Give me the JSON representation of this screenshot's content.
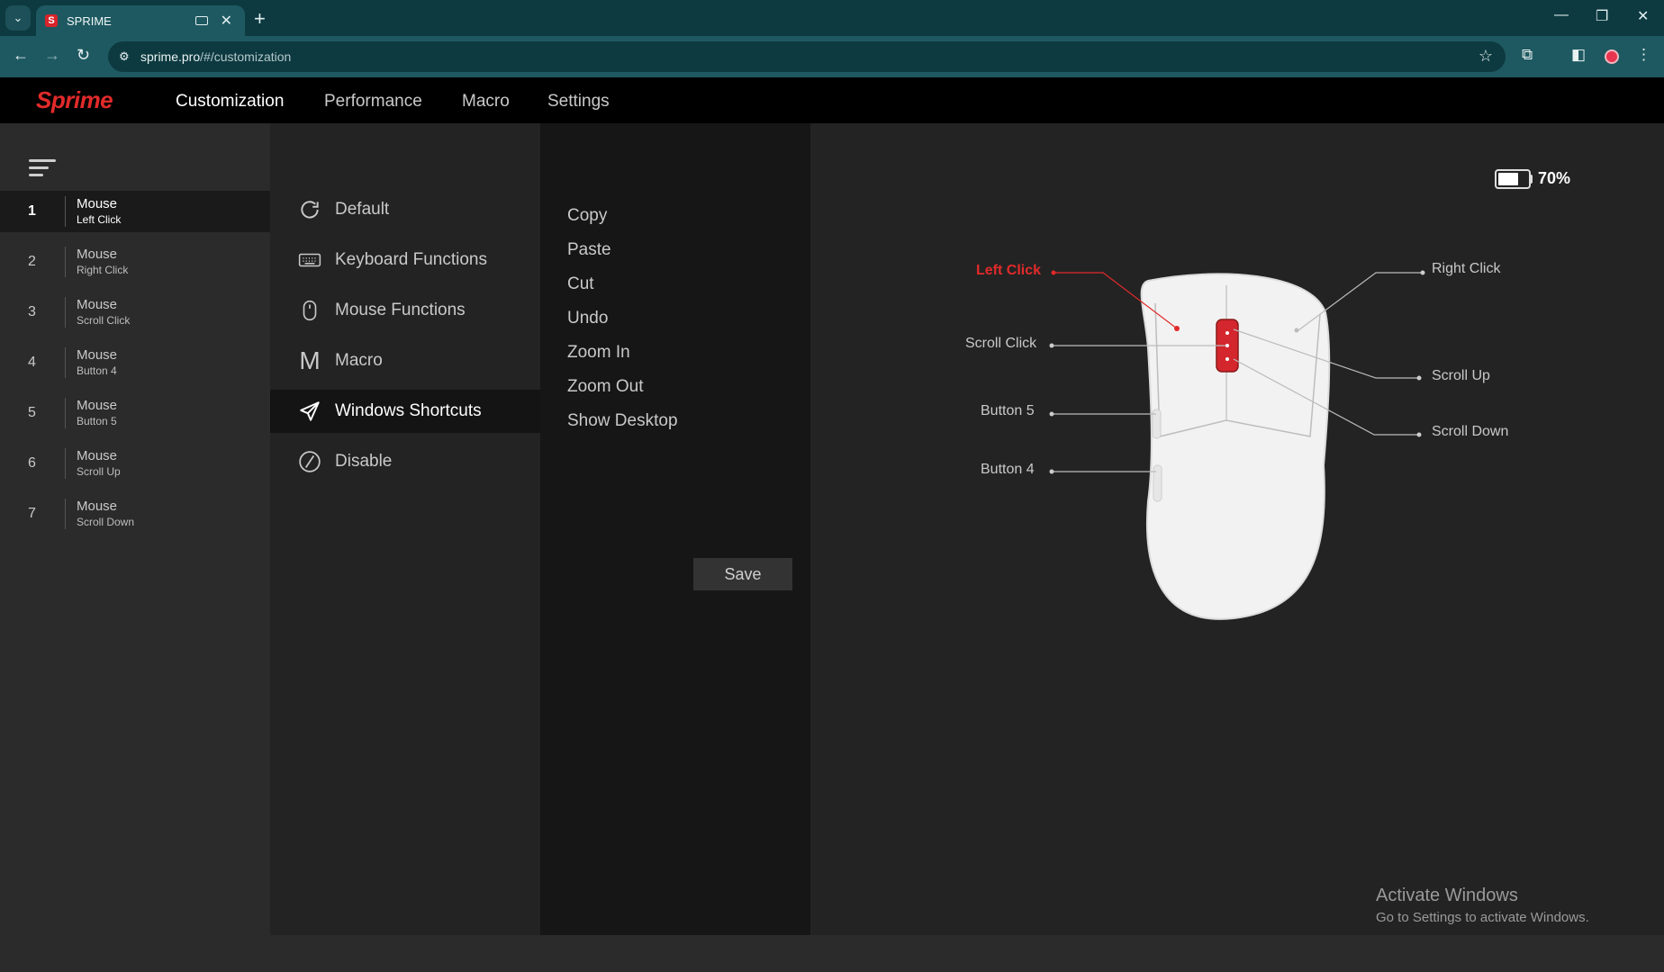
{
  "browser": {
    "tab_title": "SPRIME",
    "favicon_letter": "S",
    "url_host": "sprime.pro",
    "url_path": "/#/customization"
  },
  "app": {
    "logo": "Sprime",
    "nav": [
      "Customization",
      "Performance",
      "Macro",
      "Settings"
    ],
    "active_nav": "Customization"
  },
  "buttons": [
    {
      "num": "1",
      "title": "Mouse",
      "sub": "Left Click",
      "active": true
    },
    {
      "num": "2",
      "title": "Mouse",
      "sub": "Right Click",
      "active": false
    },
    {
      "num": "3",
      "title": "Mouse",
      "sub": "Scroll Click",
      "active": false
    },
    {
      "num": "4",
      "title": "Mouse",
      "sub": "Button 4",
      "active": false
    },
    {
      "num": "5",
      "title": "Mouse",
      "sub": "Button 5",
      "active": false
    },
    {
      "num": "6",
      "title": "Mouse",
      "sub": "Scroll Up",
      "active": false
    },
    {
      "num": "7",
      "title": "Mouse",
      "sub": "Scroll Down",
      "active": false
    }
  ],
  "functions": [
    {
      "label": "Default",
      "icon": "refresh-icon",
      "active": false
    },
    {
      "label": "Keyboard Functions",
      "icon": "keyboard-icon",
      "active": false
    },
    {
      "label": "Mouse Functions",
      "icon": "mouse-icon",
      "active": false
    },
    {
      "label": "Macro",
      "icon": "macro-m-icon",
      "active": false
    },
    {
      "label": "Windows Shortcuts",
      "icon": "send-icon",
      "active": true
    },
    {
      "label": "Disable",
      "icon": "disable-icon",
      "active": false
    }
  ],
  "shortcuts": [
    "Copy",
    "Paste",
    "Cut",
    "Undo",
    "Zoom In",
    "Zoom Out",
    "Show Desktop"
  ],
  "save_label": "Save",
  "battery": {
    "percent_label": "70%",
    "level": 0.7
  },
  "mouse_labels": {
    "left_click": "Left Click",
    "right_click": "Right Click",
    "scroll_click": "Scroll Click",
    "scroll_up": "Scroll Up",
    "scroll_down": "Scroll Down",
    "button5": "Button 5",
    "button4": "Button 4"
  },
  "colors": {
    "accent": "#e22a2a"
  },
  "watermark": {
    "line1": "Activate Windows",
    "line2": "Go to Settings to activate Windows."
  }
}
